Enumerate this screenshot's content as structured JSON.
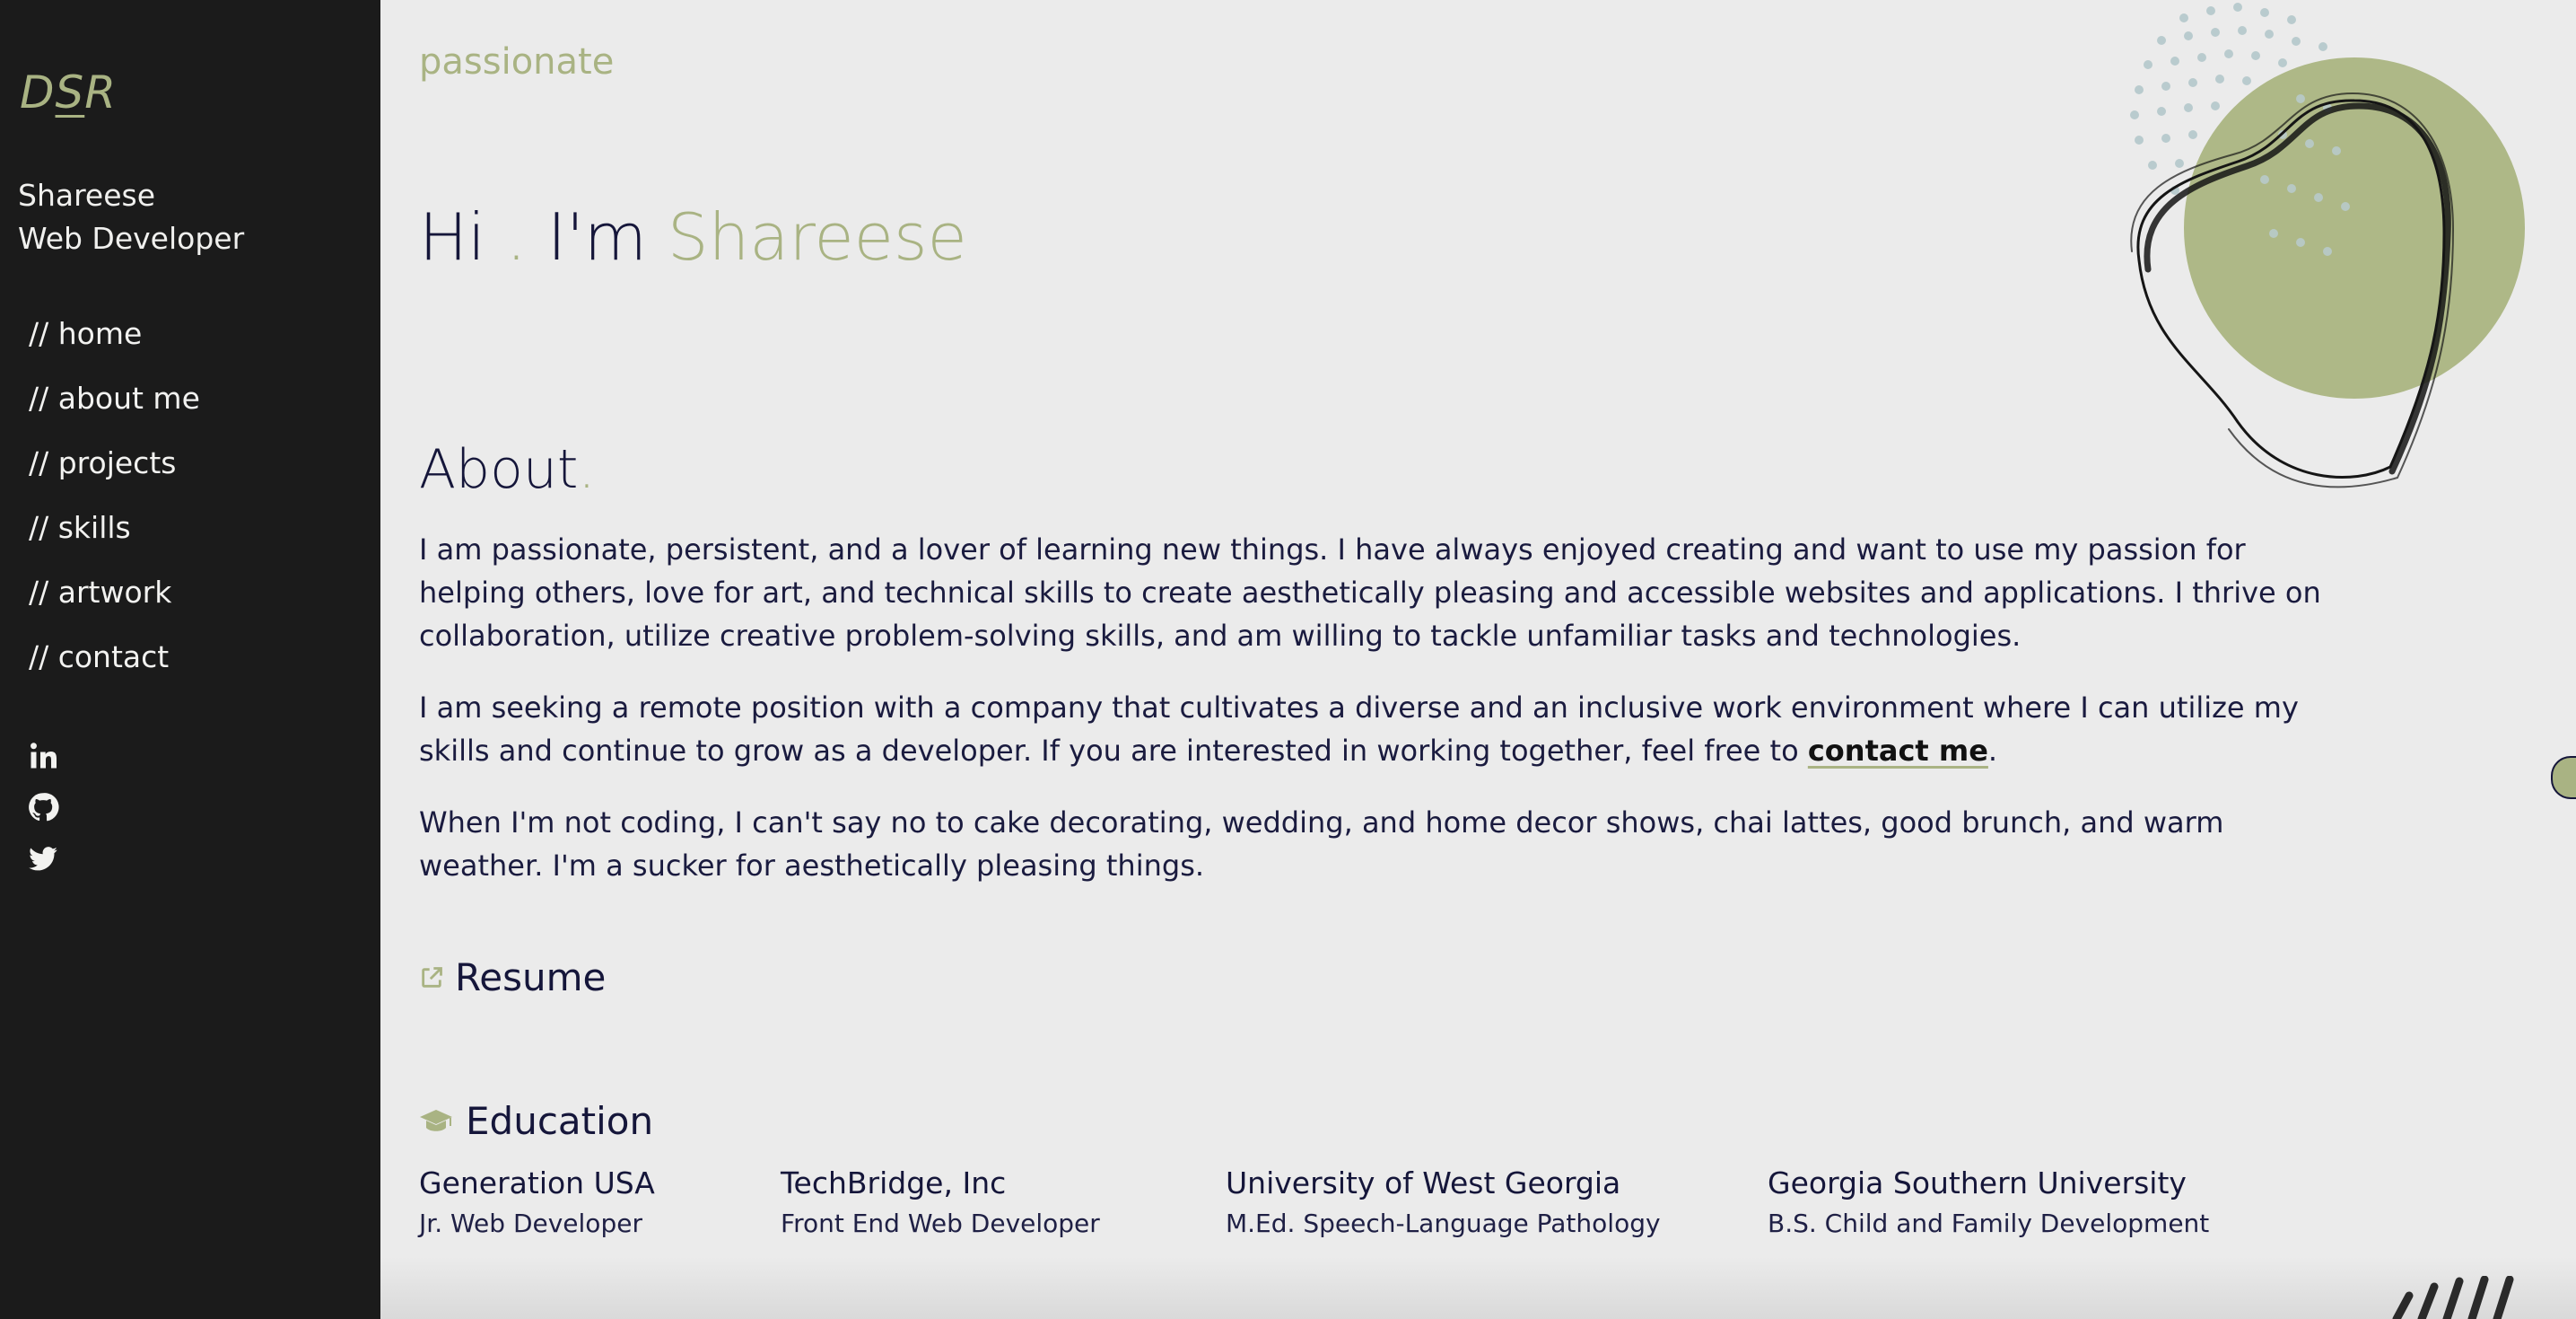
{
  "brand": {
    "logo_prefix": "D",
    "logo_mid": "S",
    "logo_suffix": "R"
  },
  "profile": {
    "name": "Shareese",
    "role": "Web Developer"
  },
  "nav": [
    {
      "label": "// home"
    },
    {
      "label": "// about me"
    },
    {
      "label": "// projects"
    },
    {
      "label": "// skills"
    },
    {
      "label": "// artwork"
    },
    {
      "label": "// contact"
    }
  ],
  "social": [
    "linkedin-icon",
    "github-icon",
    "twitter-icon"
  ],
  "hero": {
    "tagline": "passionate",
    "greeting": "Hi",
    "dot": ".",
    "im": "I'm",
    "name": "Shareese"
  },
  "about": {
    "heading": "About",
    "heading_dot": ".",
    "p1": "I am passionate, persistent, and a lover of learning new things. I have always enjoyed creating and want to use my passion for helping others, love for art, and technical skills to create aesthetically pleasing and accessible websites and applications. I thrive on collaboration, utilize creative problem-solving skills, and am willing to tackle unfamiliar tasks and technologies.",
    "p2_before": "I am seeking a remote position with a company that cultivates a diverse and an inclusive work environment where I can utilize my skills and continue to grow as a developer. If you are interested in working together, feel free to ",
    "p2_link": "contact me",
    "p2_after": ".",
    "p3": "When I'm not coding, I can't say no to cake decorating, wedding, and home decor shows, chai lattes, good brunch, and warm weather. I'm a sucker for aesthetically pleasing things."
  },
  "resume": {
    "label": "Resume"
  },
  "education": {
    "heading": "Education",
    "items": [
      {
        "school": "Generation USA",
        "degree": "Jr. Web Developer"
      },
      {
        "school": "TechBridge, Inc",
        "degree": "Front End Web Developer"
      },
      {
        "school": "University of West Georgia",
        "degree": "M.Ed. Speech-Language Pathology"
      },
      {
        "school": "Georgia Southern University",
        "degree": "B.S. Child and Family Development"
      }
    ]
  },
  "colors": {
    "accent": "#a9b383",
    "sidebar": "#1b1b1b",
    "background": "#ebebeb",
    "text": "#15163a"
  }
}
